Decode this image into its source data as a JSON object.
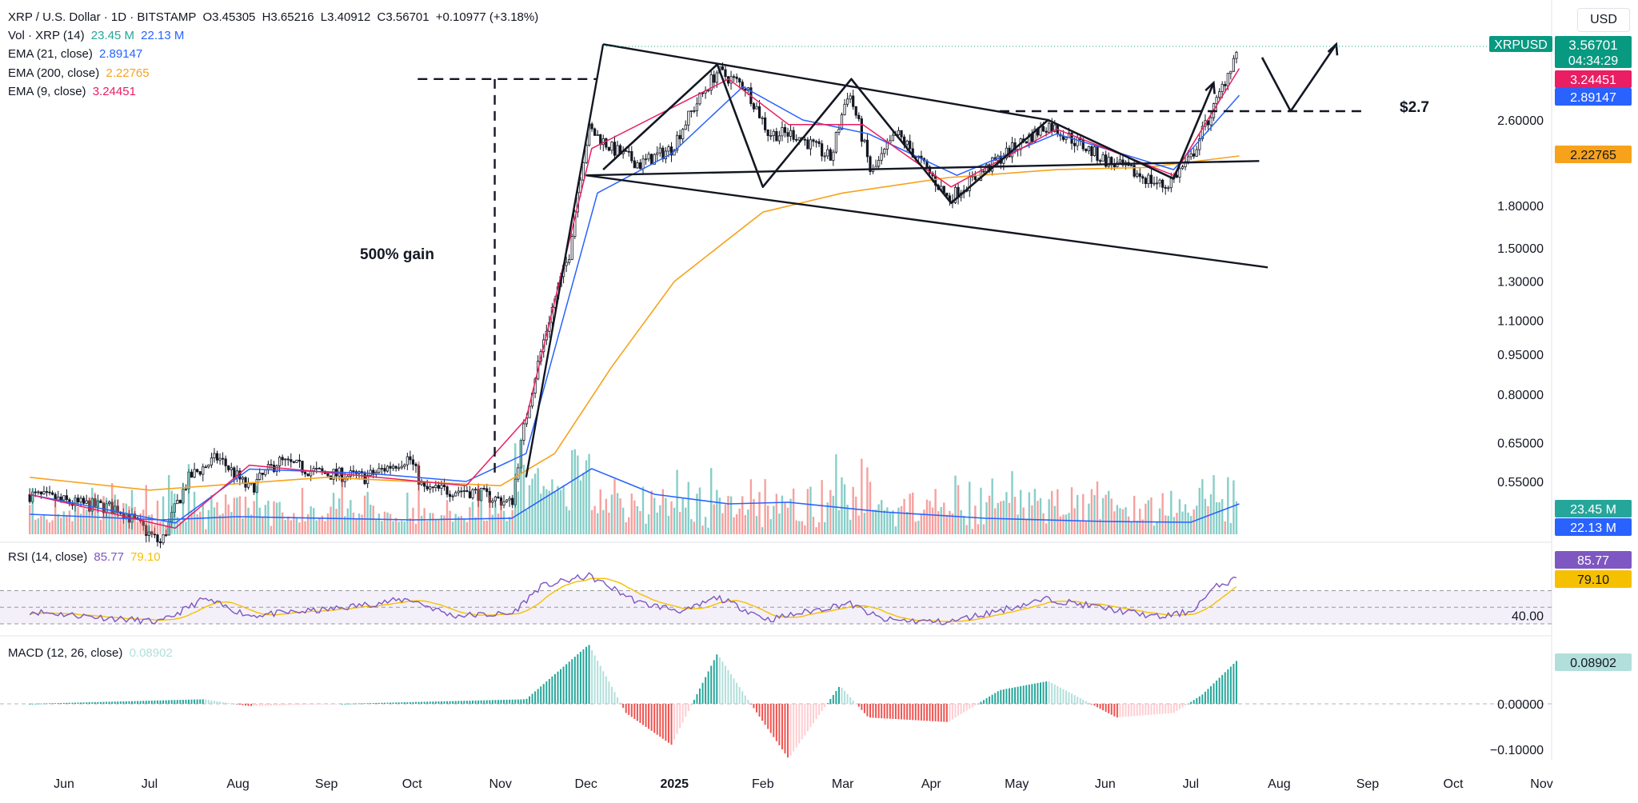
{
  "header": {
    "symbol": "XRP / U.S. Dollar · 1D · BITSTAMP",
    "open": "O3.45305",
    "high": "H3.65216",
    "low": "L3.40912",
    "close": "C3.56701",
    "change": "+0.10977 (+3.18%)",
    "vol_label": "Vol · XRP (14)",
    "vol_value": "23.45 M",
    "vol_ma_value": "22.13 M",
    "ema21_label": "EMA (21, close)",
    "ema21_value": "2.89147",
    "ema200_label": "EMA (200, close)",
    "ema200_value": "2.22765",
    "ema9_label": "EMA (9, close)",
    "ema9_value": "3.24451"
  },
  "currency": "USD",
  "badges": {
    "ticker": "XRPUSD",
    "price": "3.56701",
    "countdown": "04:34:29",
    "ema9": "3.24451",
    "ema21": "2.89147",
    "ema200": "2.22765",
    "vol": "23.45 M",
    "vol_ma": "22.13 M",
    "rsi": "85.77",
    "rsi_ma": "79.10",
    "macd": "0.08902"
  },
  "annotations": {
    "gain": "500% gain",
    "level": "$2.7"
  },
  "rsi_panel": {
    "label": "RSI (14, close)",
    "value": "85.77",
    "ma_value": "79.10",
    "tick": "40.00"
  },
  "macd_panel": {
    "label": "MACD (12, 26, close)",
    "value": "0.08902",
    "ticks": [
      "0.00000",
      "−0.10000"
    ]
  },
  "colors": {
    "up": "#26a69a",
    "down": "#ef5350",
    "ema9": "#e91e63",
    "ema21": "#2962ff",
    "ema200": "#f7a21b",
    "rsi": "#7e57c2",
    "rsi_ma": "#f5c000",
    "ticker_badge": "#089981",
    "text": "#131722",
    "axis": "#131722"
  },
  "chart_data": {
    "type": "candlestick",
    "title": "XRP / U.S. Dollar · 1D · BITSTAMP",
    "scale": "log",
    "price_ticks": [
      "2.60000",
      "1.80000",
      "1.50000",
      "1.30000",
      "1.10000",
      "0.95000",
      "0.80000",
      "0.65000",
      "0.55000"
    ],
    "x_ticks": [
      "Jun",
      "Jul",
      "Aug",
      "Sep",
      "Oct",
      "Nov",
      "Dec",
      "2025",
      "Feb",
      "Mar",
      "Apr",
      "May",
      "Jun",
      "Jul",
      "Aug",
      "Sep",
      "Oct",
      "Nov"
    ],
    "price_path": [
      [
        "2024-05-20",
        0.52
      ],
      [
        "2024-06-05",
        0.5
      ],
      [
        "2024-06-20",
        0.49
      ],
      [
        "2024-07-05",
        0.42
      ],
      [
        "2024-07-15",
        0.56
      ],
      [
        "2024-07-25",
        0.61
      ],
      [
        "2024-08-05",
        0.53
      ],
      [
        "2024-08-15",
        0.6
      ],
      [
        "2024-08-30",
        0.57
      ],
      [
        "2024-09-15",
        0.56
      ],
      [
        "2024-09-30",
        0.61
      ],
      [
        "2024-10-05",
        0.53
      ],
      [
        "2024-10-20",
        0.53
      ],
      [
        "2024-11-05",
        0.5
      ],
      [
        "2024-11-15",
        0.95
      ],
      [
        "2024-11-25",
        1.45
      ],
      [
        "2024-12-02",
        2.5
      ],
      [
        "2024-12-10",
        2.3
      ],
      [
        "2024-12-20",
        2.15
      ],
      [
        "2024-12-31",
        2.3
      ],
      [
        "2025-01-16",
        3.2
      ],
      [
        "2025-01-26",
        3.0
      ],
      [
        "2025-02-03",
        2.45
      ],
      [
        "2025-02-12",
        2.45
      ],
      [
        "2025-02-25",
        2.2
      ],
      [
        "2025-03-03",
        2.95
      ],
      [
        "2025-03-11",
        2.05
      ],
      [
        "2025-03-20",
        2.45
      ],
      [
        "2025-04-07",
        1.85
      ],
      [
        "2025-04-20",
        2.1
      ],
      [
        "2025-05-12",
        2.55
      ],
      [
        "2025-05-31",
        2.2
      ],
      [
        "2025-06-22",
        1.95
      ],
      [
        "2025-07-01",
        2.2
      ],
      [
        "2025-07-10",
        2.8
      ],
      [
        "2025-07-18",
        3.56701
      ]
    ],
    "ema200_path": [
      [
        "2024-05-20",
        0.56
      ],
      [
        "2024-07-01",
        0.53
      ],
      [
        "2024-09-01",
        0.56
      ],
      [
        "2024-11-01",
        0.54
      ],
      [
        "2024-11-20",
        0.62
      ],
      [
        "2024-12-10",
        0.9
      ],
      [
        "2025-01-01",
        1.3
      ],
      [
        "2025-02-01",
        1.75
      ],
      [
        "2025-03-01",
        1.9
      ],
      [
        "2025-04-07",
        2.03
      ],
      [
        "2025-05-15",
        2.1
      ],
      [
        "2025-06-15",
        2.12
      ],
      [
        "2025-07-18",
        2.22765
      ]
    ],
    "ema21_path": [
      [
        "2024-05-20",
        0.52
      ],
      [
        "2024-07-10",
        0.46
      ],
      [
        "2024-08-05",
        0.58
      ],
      [
        "2024-09-15",
        0.57
      ],
      [
        "2024-10-20",
        0.55
      ],
      [
        "2024-11-10",
        0.62
      ],
      [
        "2024-12-05",
        1.9
      ],
      [
        "2024-12-31",
        2.25
      ],
      [
        "2025-01-25",
        3.0
      ],
      [
        "2025-02-15",
        2.6
      ],
      [
        "2025-03-10",
        2.45
      ],
      [
        "2025-04-10",
        2.05
      ],
      [
        "2025-05-15",
        2.45
      ],
      [
        "2025-06-25",
        2.1
      ],
      [
        "2025-07-18",
        2.89147
      ]
    ],
    "ema9_path": [
      [
        "2024-05-20",
        0.52
      ],
      [
        "2024-07-10",
        0.45
      ],
      [
        "2024-08-05",
        0.59
      ],
      [
        "2024-10-20",
        0.54
      ],
      [
        "2024-11-10",
        0.72
      ],
      [
        "2024-12-03",
        2.3
      ],
      [
        "2025-01-20",
        3.1
      ],
      [
        "2025-02-10",
        2.55
      ],
      [
        "2025-03-08",
        2.55
      ],
      [
        "2025-04-08",
        1.95
      ],
      [
        "2025-05-15",
        2.5
      ],
      [
        "2025-06-25",
        2.05
      ],
      [
        "2025-07-18",
        3.24451
      ]
    ],
    "drawings": {
      "upper_line": [
        [
          "2024-12-07",
          3.6
        ],
        [
          "2025-05-12",
          2.6
        ]
      ],
      "resistance_line": [
        [
          "2024-12-01",
          2.05
        ],
        [
          "2025-07-25",
          2.18
        ]
      ],
      "lower_line": [
        [
          "2024-12-01",
          2.05
        ],
        [
          "2025-07-28",
          1.38
        ]
      ],
      "gain_box_top": [
        [
          "2024-10-03",
          3.1
        ],
        [
          "2024-12-05",
          3.1
        ]
      ],
      "zigzag": [
        [
          "2024-12-07",
          2.1
        ],
        [
          "2025-01-16",
          3.3
        ],
        [
          "2025-02-01",
          1.95
        ],
        [
          "2025-03-04",
          3.1
        ],
        [
          "2025-04-08",
          1.82
        ],
        [
          "2025-05-12",
          2.6
        ],
        [
          "2025-06-25",
          2.02
        ],
        [
          "2025-07-09",
          3.05
        ]
      ],
      "projection": [
        [
          "2025-07-26",
          3.4
        ],
        [
          "2025-08-05",
          2.7
        ],
        [
          "2025-08-21",
          3.6
        ]
      ],
      "level_2_7": [
        [
          "2025-04-25",
          2.7
        ],
        [
          "2025-08-30",
          2.7
        ]
      ]
    },
    "rsi_path": [
      [
        "2024-05-20",
        45
      ],
      [
        "2024-07-05",
        32
      ],
      [
        "2024-07-20",
        60
      ],
      [
        "2024-08-05",
        40
      ],
      [
        "2024-09-01",
        47
      ],
      [
        "2024-09-30",
        60
      ],
      [
        "2024-10-15",
        40
      ],
      [
        "2024-11-05",
        42
      ],
      [
        "2024-11-15",
        75
      ],
      [
        "2024-12-02",
        88
      ],
      [
        "2024-12-20",
        55
      ],
      [
        "2025-01-05",
        45
      ],
      [
        "2025-01-16",
        62
      ],
      [
        "2025-02-03",
        35
      ],
      [
        "2025-03-03",
        55
      ],
      [
        "2025-03-15",
        35
      ],
      [
        "2025-04-07",
        32
      ],
      [
        "2025-05-12",
        60
      ],
      [
        "2025-06-20",
        38
      ],
      [
        "2025-07-01",
        45
      ],
      [
        "2025-07-10",
        75
      ],
      [
        "2025-07-18",
        85.77
      ]
    ],
    "macd_hist_points": [
      [
        "2024-05-20",
        0
      ],
      [
        "2024-07-20",
        0.01
      ],
      [
        "2024-08-05",
        -0.005
      ],
      [
        "2024-11-10",
        0.01
      ],
      [
        "2024-12-02",
        0.13
      ],
      [
        "2024-12-15",
        -0.02
      ],
      [
        "2024-12-31",
        -0.09
      ],
      [
        "2025-01-16",
        0.11
      ],
      [
        "2025-01-31",
        -0.03
      ],
      [
        "2025-02-10",
        -0.12
      ],
      [
        "2025-02-28",
        0.04
      ],
      [
        "2025-03-10",
        -0.03
      ],
      [
        "2025-04-07",
        -0.04
      ],
      [
        "2025-04-25",
        0.03
      ],
      [
        "2025-05-12",
        0.05
      ],
      [
        "2025-06-05",
        -0.03
      ],
      [
        "2025-06-25",
        -0.02
      ],
      [
        "2025-07-05",
        0.02
      ],
      [
        "2025-07-18",
        0.1
      ]
    ]
  }
}
